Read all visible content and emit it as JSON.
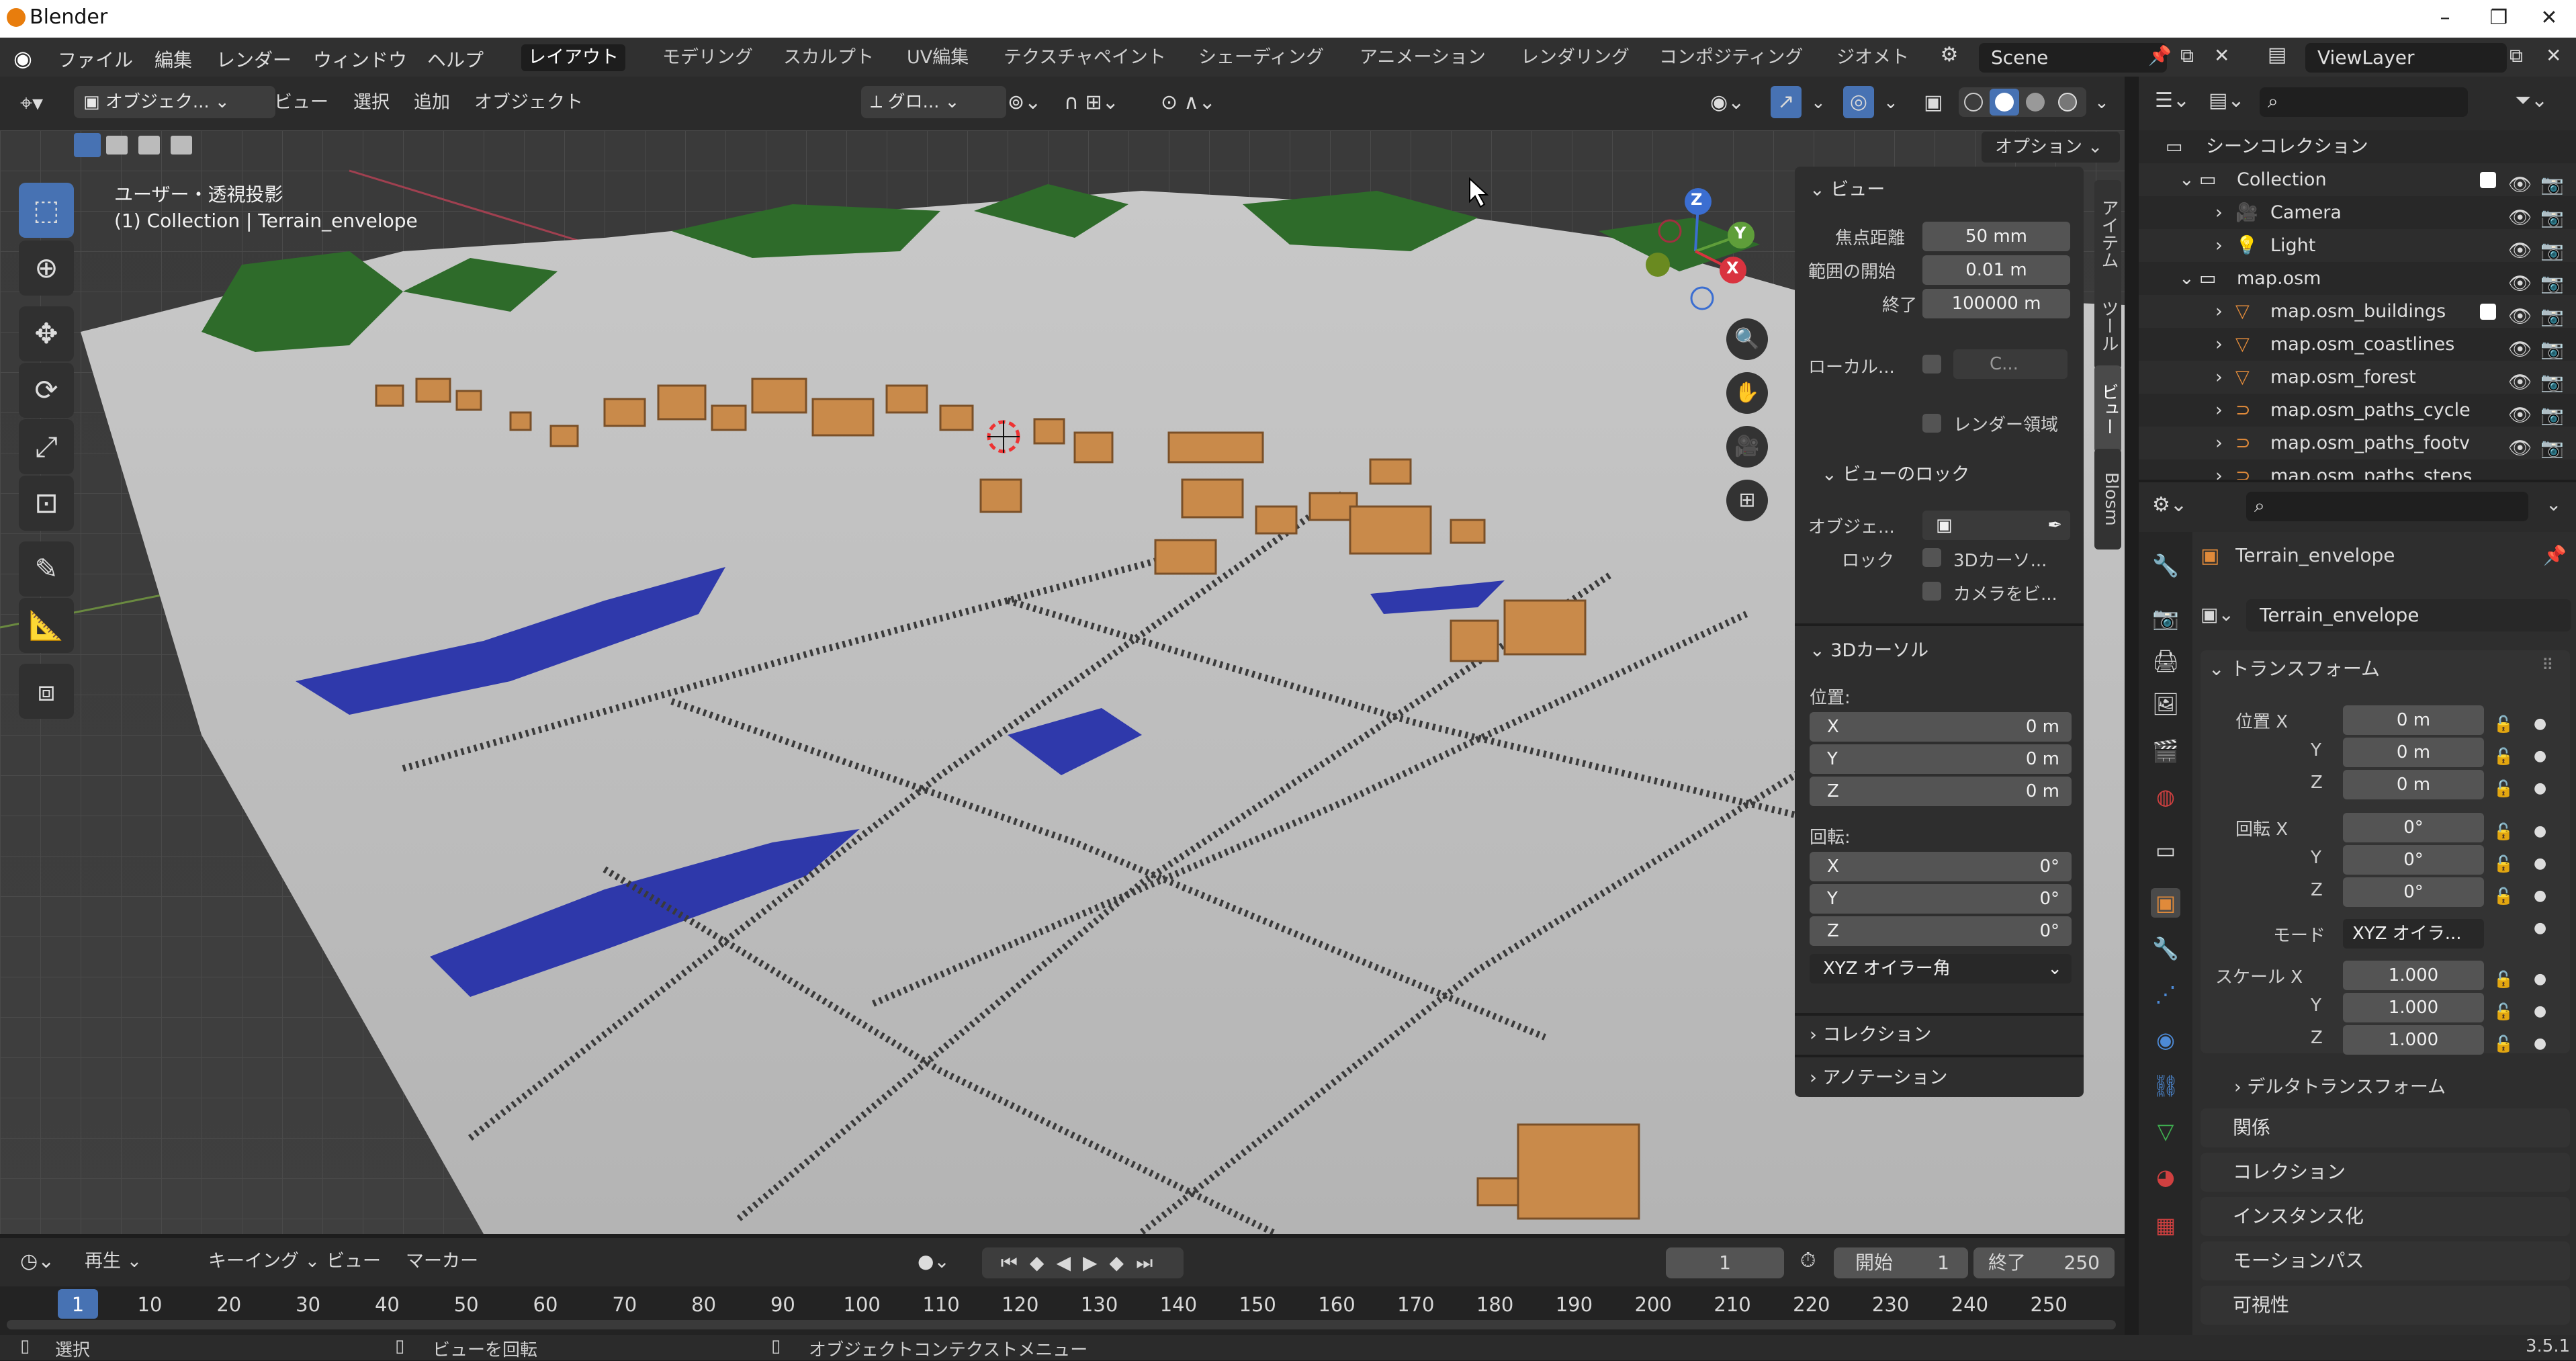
{
  "window": {
    "title": "Blender",
    "version": "3.5.1"
  },
  "menu": {
    "file": "ファイル",
    "edit": "編集",
    "render": "レンダー",
    "window": "ウィンドウ",
    "help": "ヘルプ"
  },
  "workspaces": [
    "レイアウト",
    "モデリング",
    "スカルプト",
    "UV編集",
    "テクスチャペイント",
    "シェーディング",
    "アニメーション",
    "レンダリング",
    "コンポジティング",
    "ジオメト"
  ],
  "scene": "Scene",
  "view_layer": "ViewLayer",
  "viewport_header": {
    "mode": "オブジェク...",
    "view": "ビュー",
    "select": "選択",
    "add": "追加",
    "object": "オブジェクト",
    "orientation": "グロ...",
    "options": "オプション"
  },
  "viewport": {
    "projection": "ユーザー・透視投影",
    "context": "(1) Collection | Terrain_envelope",
    "gizmo": {
      "x": "X",
      "y": "Y",
      "z": "Z"
    }
  },
  "npanel": {
    "tabs": [
      "アイテム",
      "ツール",
      "ビュー",
      "Blosm"
    ],
    "view_header": "ビュー",
    "focal_label": "焦点距離",
    "focal_value": "50 mm",
    "clip_start_label": "範囲の開始",
    "clip_start_value": "0.01 m",
    "clip_end_label": "終了",
    "clip_end_value": "100000 m",
    "local_camera_label": "ローカル...",
    "local_camera_value": "C...",
    "render_region": "レンダー領域",
    "view_lock_header": "ビューのロック",
    "lock_object_label": "オブジェ...",
    "lock_label": "ロック",
    "lock_cursor": "3Dカーソ...",
    "lock_camera": "カメラをビ...",
    "cursor_header": "3Dカーソル",
    "location_label": "位置:",
    "loc_x": "0 m",
    "loc_y": "0 m",
    "loc_z": "0 m",
    "rotation_label": "回転:",
    "rot_x": "0°",
    "rot_y": "0°",
    "rot_z": "0°",
    "rotation_mode": "XYZ オイラー角",
    "collection_header": "コレクション",
    "annotation_header": "アノテーション",
    "axis_x": "X",
    "axis_y": "Y",
    "axis_z": "Z"
  },
  "outliner": {
    "root": "シーンコレクション",
    "rows": [
      {
        "label": "Collection",
        "kind": "collection"
      },
      {
        "label": "Camera",
        "kind": "camera"
      },
      {
        "label": "Light",
        "kind": "light"
      },
      {
        "label": "map.osm",
        "kind": "collection"
      },
      {
        "label": "map.osm_buildings",
        "kind": "mesh"
      },
      {
        "label": "map.osm_coastlines",
        "kind": "mesh"
      },
      {
        "label": "map.osm_forest",
        "kind": "mesh"
      },
      {
        "label": "map.osm_paths_cycle",
        "kind": "curve"
      },
      {
        "label": "map.osm_paths_footv",
        "kind": "curve"
      },
      {
        "label": "map.osm_paths_steps",
        "kind": "curve"
      }
    ]
  },
  "properties": {
    "object_name": "Terrain_envelope",
    "object_field": "Terrain_envelope",
    "transform_header": "トランスフォーム",
    "location_x_label": "位置 X",
    "y_label": "Y",
    "z_label": "Z",
    "loc_x": "0 m",
    "loc_y": "0 m",
    "loc_z": "0 m",
    "rotation_x_label": "回転 X",
    "rot_x": "0°",
    "rot_y": "0°",
    "rot_z": "0°",
    "mode_label": "モード",
    "mode_value": "XYZ オイラ...",
    "scale_x_label": "スケール X",
    "scale_x": "1.000",
    "scale_y": "1.000",
    "scale_z": "1.000",
    "delta_transform": "デルタトランスフォーム",
    "sections": [
      "関係",
      "コレクション",
      "インスタンス化",
      "モーションパス",
      "可視性"
    ]
  },
  "timeline": {
    "playback": "再生",
    "keying": "キーイング",
    "view": "ビュー",
    "marker": "マーカー",
    "current_frame": "1",
    "start_label": "開始",
    "start": "1",
    "end_label": "終了",
    "end": "250",
    "frames": [
      "1",
      "10",
      "20",
      "30",
      "40",
      "50",
      "60",
      "70",
      "80",
      "90",
      "100",
      "110",
      "120",
      "130",
      "140",
      "150",
      "160",
      "170",
      "180",
      "190",
      "200",
      "210",
      "220",
      "230",
      "240",
      "250"
    ]
  },
  "statusbar": {
    "select": "選択",
    "rotate": "ビューを回転",
    "context_menu": "オブジェクトコンテクストメニュー"
  },
  "colors": {
    "accent": "#4772b3",
    "terrain": "#a9a9a9",
    "building": "#c98a4a",
    "forest": "#2e6b2a",
    "water": "#1f2aa8",
    "orange_icon": "#e08a3a"
  }
}
